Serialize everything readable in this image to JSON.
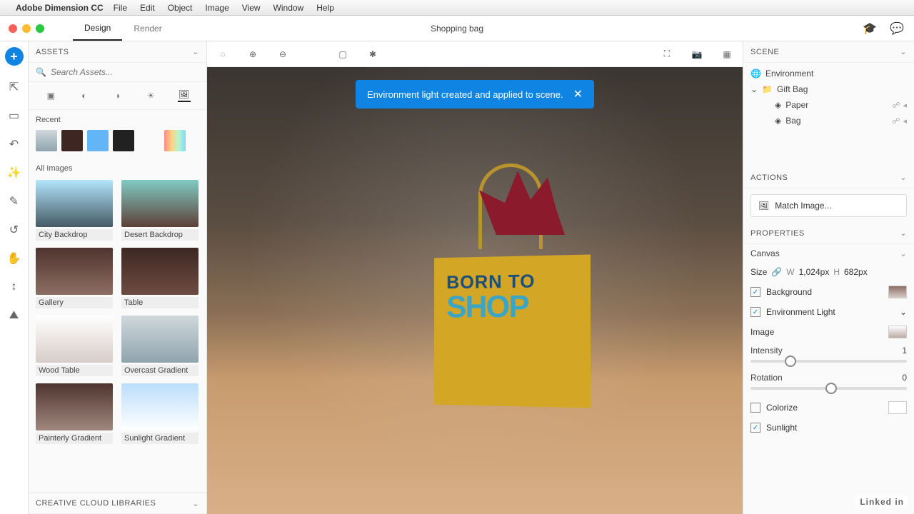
{
  "menubar": {
    "app": "Adobe Dimension CC",
    "items": [
      "File",
      "Edit",
      "Object",
      "Image",
      "View",
      "Window",
      "Help"
    ]
  },
  "titlebar": {
    "tabs": {
      "design": "Design",
      "render": "Render"
    },
    "document": "Shopping bag"
  },
  "assets": {
    "header": "Assets",
    "search_placeholder": "Search Assets...",
    "recent_label": "Recent",
    "all_label": "All Images",
    "items": [
      {
        "label": "City Backdrop"
      },
      {
        "label": "Desert Backdrop"
      },
      {
        "label": "Gallery"
      },
      {
        "label": "Table"
      },
      {
        "label": "Wood Table"
      },
      {
        "label": "Overcast Gradient"
      },
      {
        "label": "Painterly Gradient"
      },
      {
        "label": "Sunlight Gradient"
      }
    ],
    "cc_label": "Creative Cloud Libraries"
  },
  "toast": {
    "message": "Environment light created and applied to scene."
  },
  "bag": {
    "line1": "BORN TO",
    "line2": "SHOP"
  },
  "scene": {
    "header": "Scene",
    "environment": "Environment",
    "giftbag": "Gift Bag",
    "paper": "Paper",
    "bag": "Bag"
  },
  "actions": {
    "header": "Actions",
    "match": "Match Image..."
  },
  "properties": {
    "header": "Properties",
    "canvas": "Canvas",
    "size_label": "Size",
    "w_label": "W",
    "w_value": "1,024px",
    "h_label": "H",
    "h_value": "682px",
    "background": "Background",
    "env_light": "Environment Light",
    "image_label": "Image",
    "intensity_label": "Intensity",
    "intensity_value": "1",
    "rotation_label": "Rotation",
    "rotation_value": "0",
    "colorize": "Colorize",
    "sunlight": "Sunlight"
  },
  "footer": {
    "linkedin": "Linked in"
  }
}
